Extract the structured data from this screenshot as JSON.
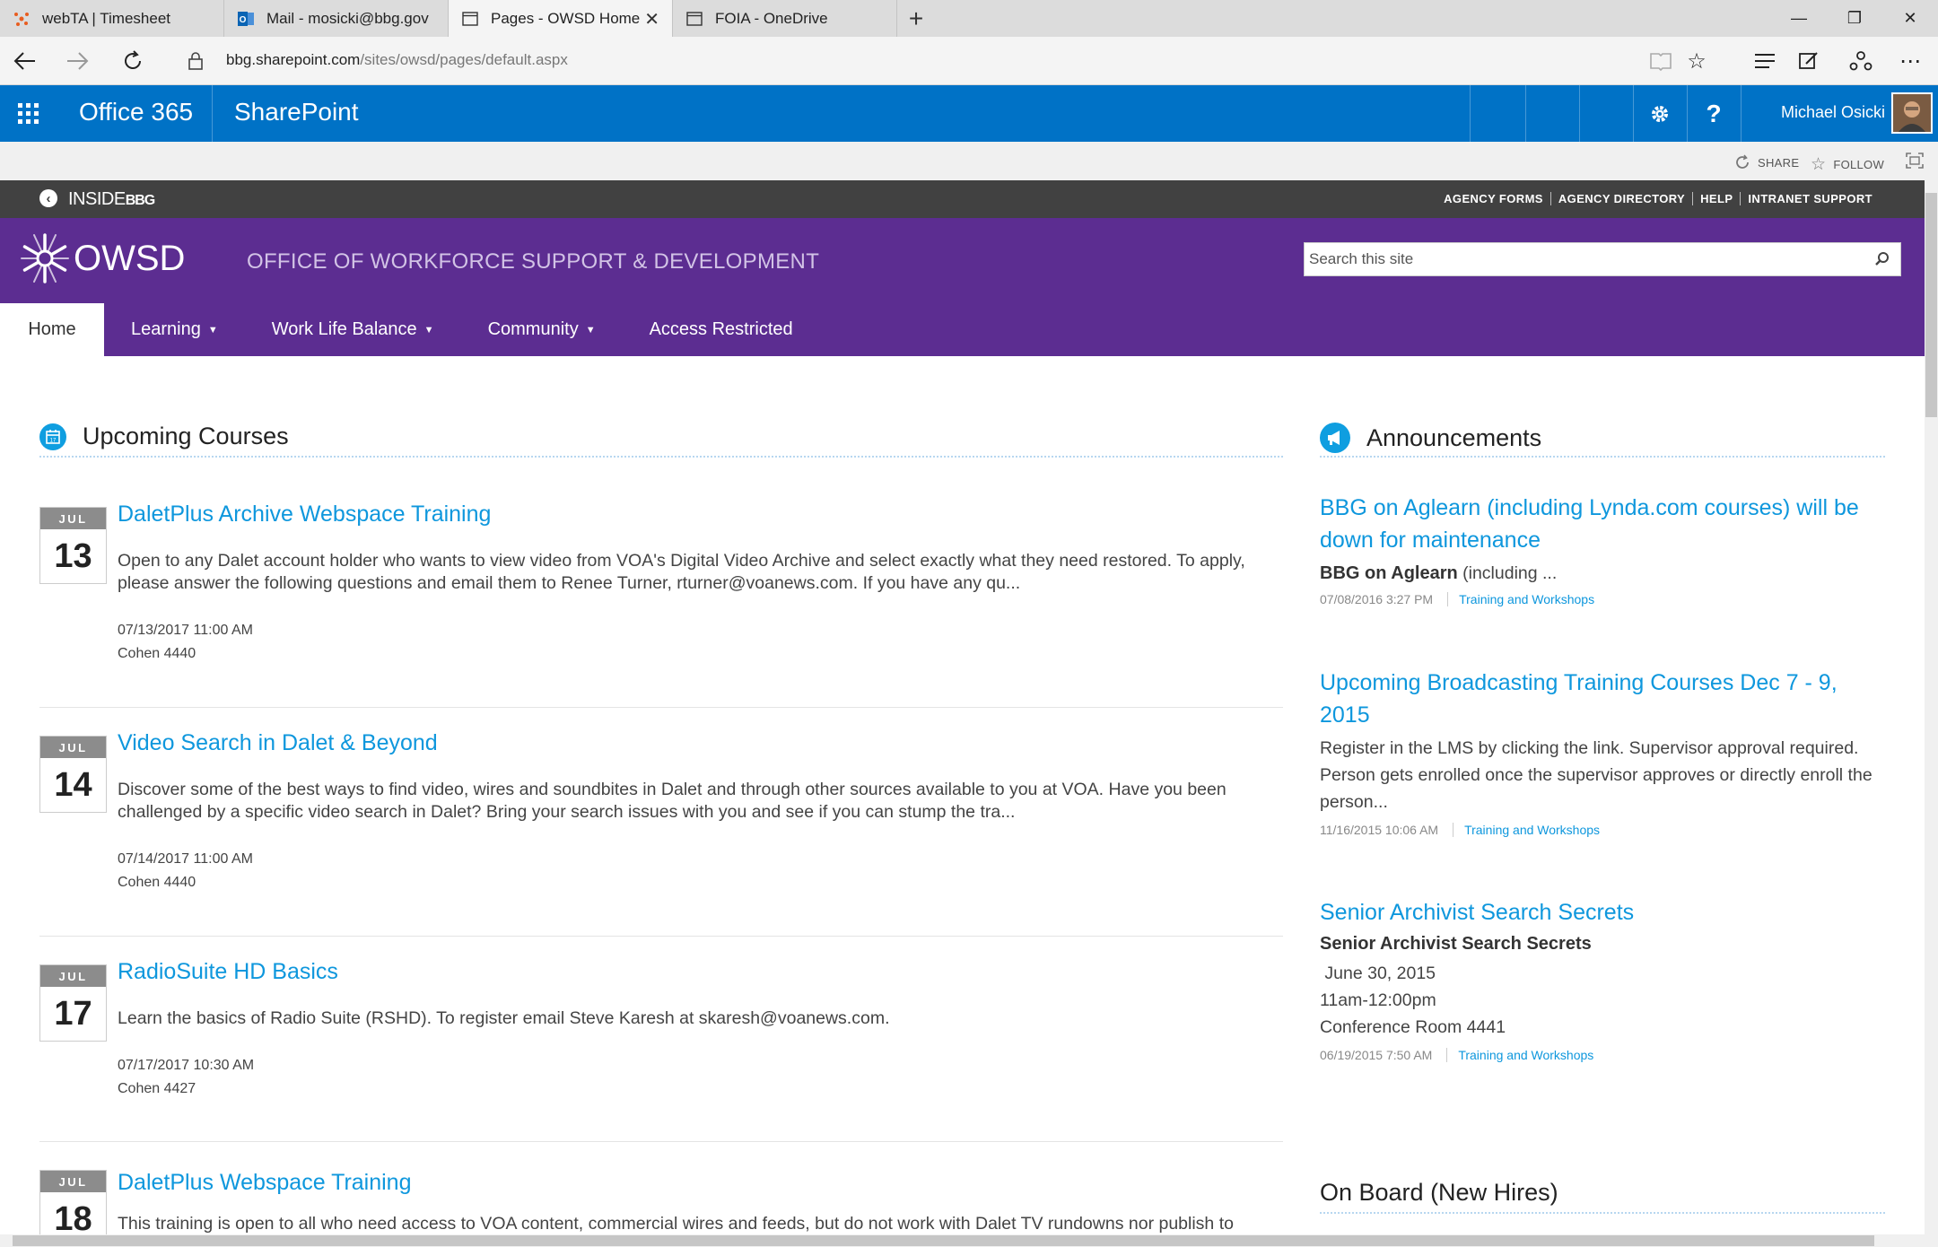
{
  "browser": {
    "tabs": [
      {
        "label": "webTA | Timesheet",
        "icon": "webta-icon",
        "active": false
      },
      {
        "label": "Mail - mosicki@bbg.gov",
        "icon": "outlook-icon",
        "active": false
      },
      {
        "label": "Pages - OWSD Home",
        "icon": "page-icon",
        "active": true
      },
      {
        "label": "FOIA - OneDrive",
        "icon": "page-icon",
        "active": false
      }
    ],
    "url_domain": "bbg.sharepoint.com",
    "url_path": "/sites/owsd/pages/default.aspx"
  },
  "suite": {
    "app_name": "Office 365",
    "product": "SharePoint",
    "user_name": "Michael Osicki",
    "accent": "#0072c6"
  },
  "ribbon": {
    "share": "SHARE",
    "follow": "FOLLOW"
  },
  "inside": {
    "logo": "INSIDE",
    "logo_suffix": "BBG",
    "links": [
      "AGENCY FORMS",
      "AGENCY DIRECTORY",
      "HELP",
      "INTRANET SUPPORT"
    ]
  },
  "site": {
    "logo_text": "OWSD",
    "title": "OFFICE OF WORKFORCE SUPPORT & DEVELOPMENT",
    "search_placeholder": "Search this site",
    "brand_color": "#5c2d91"
  },
  "nav": [
    {
      "label": "Home",
      "dropdown": false,
      "selected": true
    },
    {
      "label": "Learning",
      "dropdown": true
    },
    {
      "label": "Work Life Balance",
      "dropdown": true
    },
    {
      "label": "Community",
      "dropdown": true
    },
    {
      "label": "Access Restricted",
      "dropdown": false
    }
  ],
  "courses": {
    "heading": "Upcoming Courses",
    "items": [
      {
        "month": "JUL",
        "day": "13",
        "title": "DaletPlus Archive Webspace Training",
        "desc": "Open to any Dalet account holder who wants to view video from VOA's Digital Video Archive and select exactly what they need restored. To apply, please answer the following questions and email them to Renee Turner, rturner@voanews.com. If you have any qu...",
        "datetime": "07/13/2017 11:00 AM",
        "location": "Cohen 4440"
      },
      {
        "month": "JUL",
        "day": "14",
        "title": "Video Search in Dalet & Beyond",
        "desc": "Discover some of the best ways to find video, wires and soundbites in Dalet and through other sources available to you at VOA. Have you been challenged by a specific video search in Dalet? Bring your search issues with you and see if you can stump the tra...",
        "datetime": "07/14/2017 11:00 AM",
        "location": "Cohen 4440"
      },
      {
        "month": "JUL",
        "day": "17",
        "title": "RadioSuite HD Basics",
        "desc": "Learn the basics of Radio Suite (RSHD). To register email Steve Karesh at skaresh@voanews.com.",
        "datetime": "07/17/2017 10:30 AM",
        "location": "Cohen 4427"
      },
      {
        "month": "JUL",
        "day": "18",
        "title": "DaletPlus Webspace Training",
        "desc": "This training is open to all who need access to VOA content, commercial wires and feeds, but do not work with Dalet TV rundowns nor publish to"
      }
    ]
  },
  "announcements": {
    "heading": "Announcements",
    "items": [
      {
        "title": "BBG on Aglearn (including Lynda.com courses) will be down for maintenance",
        "bold": "BBG on Aglearn",
        "text": " (including ...",
        "date": "07/08/2016 3:27 PM",
        "category": "Training and Workshops"
      },
      {
        "title": "Upcoming Broadcasting Training Courses Dec 7 - 9, 2015",
        "text": "Register in the LMS by clicking the link.  Supervisor approval required. Person gets enrolled once the supervisor approves or directly enroll the person...",
        "date": "11/16/2015 10:06 AM",
        "category": "Training and Workshops"
      },
      {
        "title": "Senior Archivist Search Secrets",
        "bold": "Senior Archivist Search Secrets",
        "lines": [
          " June 30, 2015",
          "11am-12:00pm",
          "Conference Room 4441"
        ],
        "date": "06/19/2015 7:50 AM",
        "category": "Training and Workshops"
      }
    ]
  },
  "onboard": {
    "heading": "On Board (New Hires)"
  }
}
